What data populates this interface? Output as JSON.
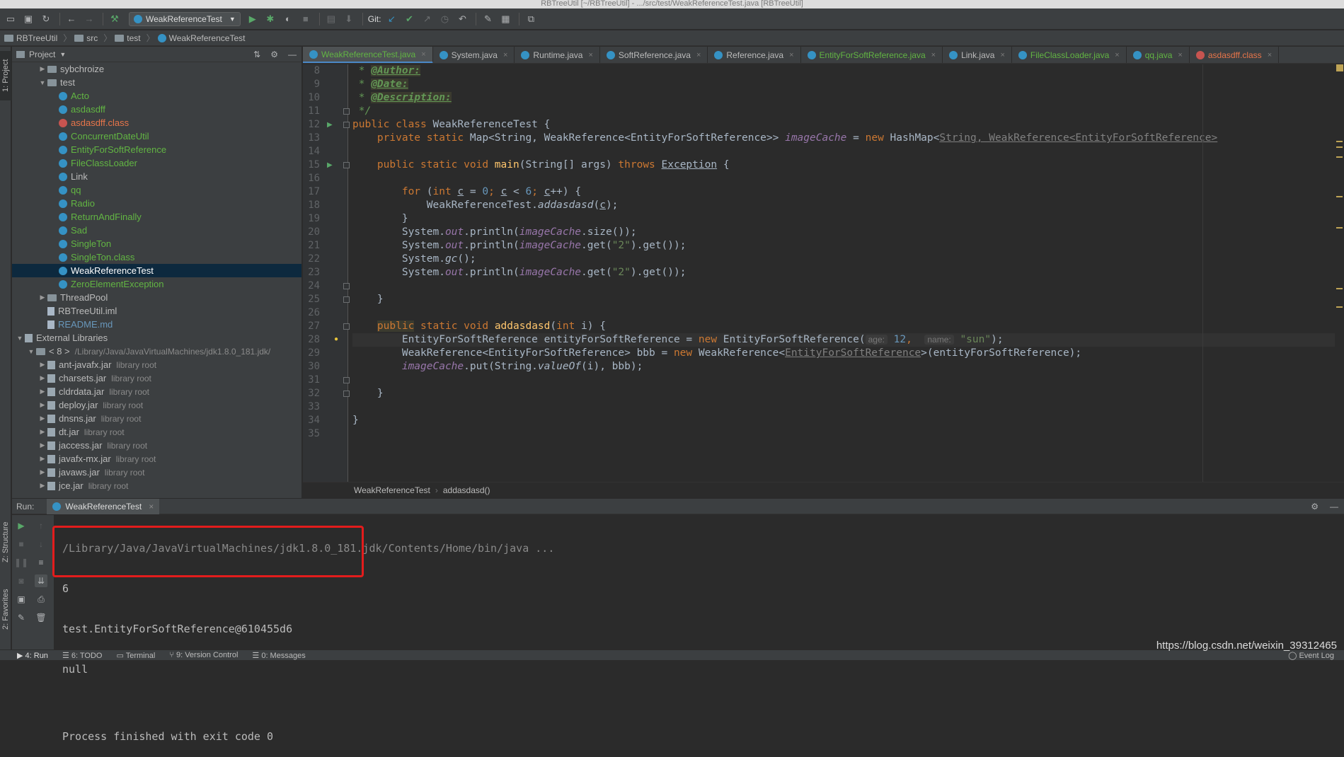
{
  "window": {
    "title": "RBTreeUtil [~/RBTreeUtil] - .../src/test/WeakReferenceTest.java [RBTreeUtil]"
  },
  "toolbar": {
    "run_config": "WeakReferenceTest",
    "git_label": "Git:"
  },
  "breadcrumb": {
    "items": [
      "RBTreeUtil",
      "src",
      "test",
      "WeakReferenceTest"
    ]
  },
  "left_strip": {
    "project": "1: Project",
    "structure": "Z: Structure",
    "favorites": "2: Favorites"
  },
  "project_panel": {
    "title": "Project",
    "tree": [
      {
        "label": "sybchroize",
        "type": "folder",
        "indent": 2,
        "arrow": "▶",
        "color": "white"
      },
      {
        "label": "test",
        "type": "folder",
        "indent": 2,
        "arrow": "▼",
        "color": "white"
      },
      {
        "label": "Acto",
        "type": "class",
        "indent": 3,
        "color": "green"
      },
      {
        "label": "asdasdff",
        "type": "class",
        "indent": 3,
        "color": "green"
      },
      {
        "label": "asdasdff.class",
        "type": "class-err",
        "indent": 3,
        "color": "red"
      },
      {
        "label": "ConcurrentDateUtil",
        "type": "class",
        "indent": 3,
        "color": "green"
      },
      {
        "label": "EntityForSoftReference",
        "type": "class",
        "indent": 3,
        "color": "green"
      },
      {
        "label": "FileClassLoader",
        "type": "class",
        "indent": 3,
        "color": "green"
      },
      {
        "label": "Link",
        "type": "class",
        "indent": 3,
        "color": "white"
      },
      {
        "label": "qq",
        "type": "class",
        "indent": 3,
        "color": "green"
      },
      {
        "label": "Radio",
        "type": "class",
        "indent": 3,
        "color": "green"
      },
      {
        "label": "ReturnAndFinally",
        "type": "class",
        "indent": 3,
        "color": "green"
      },
      {
        "label": "Sad",
        "type": "class",
        "indent": 3,
        "color": "green"
      },
      {
        "label": "SingleTon",
        "type": "class",
        "indent": 3,
        "color": "green"
      },
      {
        "label": "SingleTon.class",
        "type": "class",
        "indent": 3,
        "color": "green"
      },
      {
        "label": "WeakReferenceTest",
        "type": "class",
        "indent": 3,
        "color": "white",
        "selected": true
      },
      {
        "label": "ZeroElementException",
        "type": "class",
        "indent": 3,
        "color": "green"
      },
      {
        "label": "ThreadPool",
        "type": "folder",
        "indent": 2,
        "arrow": "▶",
        "color": "white"
      },
      {
        "label": "RBTreeUtil.iml",
        "type": "file",
        "indent": 2,
        "color": "white"
      },
      {
        "label": "README.md",
        "type": "file",
        "indent": 2,
        "color": "blue"
      },
      {
        "label": "External Libraries",
        "type": "lib",
        "indent": 0,
        "arrow": "▼",
        "color": "white"
      },
      {
        "label": "< 8 >",
        "type": "folder",
        "indent": 1,
        "arrow": "▼",
        "color": "white",
        "extra": "/Library/Java/JavaVirtualMachines/jdk1.8.0_181.jdk/"
      },
      {
        "label": "ant-javafx.jar",
        "type": "jar",
        "indent": 2,
        "arrow": "▶",
        "color": "white",
        "extra": "library root"
      },
      {
        "label": "charsets.jar",
        "type": "jar",
        "indent": 2,
        "arrow": "▶",
        "color": "white",
        "extra": "library root"
      },
      {
        "label": "cldrdata.jar",
        "type": "jar",
        "indent": 2,
        "arrow": "▶",
        "color": "white",
        "extra": "library root"
      },
      {
        "label": "deploy.jar",
        "type": "jar",
        "indent": 2,
        "arrow": "▶",
        "color": "white",
        "extra": "library root"
      },
      {
        "label": "dnsns.jar",
        "type": "jar",
        "indent": 2,
        "arrow": "▶",
        "color": "white",
        "extra": "library root"
      },
      {
        "label": "dt.jar",
        "type": "jar",
        "indent": 2,
        "arrow": "▶",
        "color": "white",
        "extra": "library root"
      },
      {
        "label": "jaccess.jar",
        "type": "jar",
        "indent": 2,
        "arrow": "▶",
        "color": "white",
        "extra": "library root"
      },
      {
        "label": "javafx-mx.jar",
        "type": "jar",
        "indent": 2,
        "arrow": "▶",
        "color": "white",
        "extra": "library root"
      },
      {
        "label": "javaws.jar",
        "type": "jar",
        "indent": 2,
        "arrow": "▶",
        "color": "white",
        "extra": "library root"
      },
      {
        "label": "jce.jar",
        "type": "jar",
        "indent": 2,
        "arrow": "▶",
        "color": "white",
        "extra": "library root"
      }
    ]
  },
  "editor_tabs": [
    {
      "label": "WeakReferenceTest.java",
      "active": true,
      "color": "green"
    },
    {
      "label": "System.java",
      "color": "white"
    },
    {
      "label": "Runtime.java",
      "color": "white"
    },
    {
      "label": "SoftReference.java",
      "color": "white"
    },
    {
      "label": "Reference.java",
      "color": "white"
    },
    {
      "label": "EntityForSoftReference.java",
      "color": "green"
    },
    {
      "label": "Link.java",
      "color": "white"
    },
    {
      "label": "FileClassLoader.java",
      "color": "green"
    },
    {
      "label": "qq.java",
      "color": "green"
    },
    {
      "label": "asdasdff.class",
      "color": "red"
    }
  ],
  "editor": {
    "first_line": 8,
    "line_numbers": [
      "8",
      "9",
      "10",
      "11",
      "12",
      "13",
      "14",
      "15",
      "16",
      "17",
      "18",
      "19",
      "20",
      "21",
      "22",
      "23",
      "24",
      "25",
      "26",
      "27",
      "28",
      "29",
      "30",
      "31",
      "32",
      "33",
      "34",
      "35"
    ],
    "lines": [
      [
        {
          "t": " * ",
          "c": "cm"
        },
        {
          "t": "@Author:",
          "c": "tag"
        }
      ],
      [
        {
          "t": " * ",
          "c": "cm"
        },
        {
          "t": "@Date:",
          "c": "tag"
        }
      ],
      [
        {
          "t": " * ",
          "c": "cm"
        },
        {
          "t": "@Description:",
          "c": "tag"
        }
      ],
      [
        {
          "t": " */",
          "c": "cm"
        }
      ],
      [
        {
          "t": "public class ",
          "c": "kw"
        },
        {
          "t": "WeakReferenceTest {",
          "c": ""
        }
      ],
      [
        {
          "t": "    private static ",
          "c": "kw"
        },
        {
          "t": "Map<String, WeakReference<EntityForSoftReference>> ",
          "c": ""
        },
        {
          "t": "imageCache",
          "c": "fld"
        },
        {
          "t": " = ",
          "c": ""
        },
        {
          "t": "new ",
          "c": "kw"
        },
        {
          "t": "HashMap<",
          "c": ""
        },
        {
          "t": "String, WeakReference<EntityForSoftReference>",
          "c": "grey ul"
        }
      ],
      [],
      [
        {
          "t": "    public static void ",
          "c": "kw"
        },
        {
          "t": "main",
          "c": "fn"
        },
        {
          "t": "(String[] args) ",
          "c": ""
        },
        {
          "t": "throws ",
          "c": "kw"
        },
        {
          "t": "Exception",
          "c": "ul"
        },
        {
          "t": " {",
          "c": ""
        }
      ],
      [],
      [
        {
          "t": "        for ",
          "c": "kw"
        },
        {
          "t": "(",
          "c": ""
        },
        {
          "t": "int ",
          "c": "kw"
        },
        {
          "t": "c",
          "c": "ul"
        },
        {
          "t": " = ",
          "c": ""
        },
        {
          "t": "0",
          "c": "num"
        },
        {
          "t": "; ",
          "c": "kw"
        },
        {
          "t": "c",
          "c": "ul"
        },
        {
          "t": " < ",
          "c": ""
        },
        {
          "t": "6",
          "c": "num"
        },
        {
          "t": "; ",
          "c": "kw"
        },
        {
          "t": "c",
          "c": "ul"
        },
        {
          "t": "++) {",
          "c": ""
        }
      ],
      [
        {
          "t": "            WeakReferenceTest.",
          "c": ""
        },
        {
          "t": "addasdasd",
          "c": "st"
        },
        {
          "t": "(",
          "c": ""
        },
        {
          "t": "c",
          "c": "ul"
        },
        {
          "t": ");",
          "c": ""
        }
      ],
      [
        {
          "t": "        }",
          "c": ""
        }
      ],
      [
        {
          "t": "        System.",
          "c": ""
        },
        {
          "t": "out",
          "c": "fld"
        },
        {
          "t": ".println(",
          "c": ""
        },
        {
          "t": "imageCache",
          "c": "fld"
        },
        {
          "t": ".size());",
          "c": ""
        }
      ],
      [
        {
          "t": "        System.",
          "c": ""
        },
        {
          "t": "out",
          "c": "fld"
        },
        {
          "t": ".println(",
          "c": ""
        },
        {
          "t": "imageCache",
          "c": "fld"
        },
        {
          "t": ".get(",
          "c": ""
        },
        {
          "t": "\"2\"",
          "c": "str"
        },
        {
          "t": ").get());",
          "c": ""
        }
      ],
      [
        {
          "t": "        System.",
          "c": ""
        },
        {
          "t": "gc",
          "c": "st"
        },
        {
          "t": "();",
          "c": ""
        }
      ],
      [
        {
          "t": "        System.",
          "c": ""
        },
        {
          "t": "out",
          "c": "fld"
        },
        {
          "t": ".println(",
          "c": ""
        },
        {
          "t": "imageCache",
          "c": "fld"
        },
        {
          "t": ".get(",
          "c": ""
        },
        {
          "t": "\"2\"",
          "c": "str"
        },
        {
          "t": ").get());",
          "c": ""
        }
      ],
      [],
      [
        {
          "t": "    }",
          "c": ""
        }
      ],
      [],
      [
        {
          "t": "    ",
          "c": ""
        },
        {
          "t": "public",
          "c": "kw tagbg"
        },
        {
          "t": " static void ",
          "c": "kw"
        },
        {
          "t": "addasdasd",
          "c": "fn"
        },
        {
          "t": "(",
          "c": ""
        },
        {
          "t": "int ",
          "c": "kw"
        },
        {
          "t": "i) {",
          "c": ""
        }
      ],
      [
        {
          "t": "        EntityForSoftReference entityForSoftReference = ",
          "c": ""
        },
        {
          "t": "new ",
          "c": "kw"
        },
        {
          "t": "EntityForSoftReference(",
          "c": ""
        },
        {
          "t": "age:",
          "c": "hint"
        },
        {
          "t": " 12",
          "c": "num"
        },
        {
          "t": ",  ",
          "c": "kw"
        },
        {
          "t": "name:",
          "c": "hint"
        },
        {
          "t": " \"sun\"",
          "c": "str"
        },
        {
          "t": ");",
          "c": ""
        }
      ],
      [
        {
          "t": "        WeakReference<EntityForSoftReference> bbb = ",
          "c": ""
        },
        {
          "t": "new ",
          "c": "kw"
        },
        {
          "t": "WeakReference<",
          "c": ""
        },
        {
          "t": "EntityForSoftReference",
          "c": "grey ul"
        },
        {
          "t": ">(entityForSoftReference);",
          "c": ""
        }
      ],
      [
        {
          "t": "        ",
          "c": ""
        },
        {
          "t": "imageCache",
          "c": "fld"
        },
        {
          "t": ".put(String.",
          "c": ""
        },
        {
          "t": "valueOf",
          "c": "st"
        },
        {
          "t": "(i), bbb);",
          "c": ""
        }
      ],
      [],
      [
        {
          "t": "    }",
          "c": ""
        }
      ],
      [],
      [
        {
          "t": "}",
          "c": ""
        }
      ],
      []
    ]
  },
  "editor_breadcrumb": {
    "class_name": "WeakReferenceTest",
    "method": "addasdasd()"
  },
  "run_panel": {
    "label": "Run:",
    "tab": "WeakReferenceTest"
  },
  "console": {
    "lines": [
      "/Library/Java/JavaVirtualMachines/jdk1.8.0_181.jdk/Contents/Home/bin/java ...",
      "6",
      "test.EntityForSoftReference@610455d6",
      "null",
      "",
      "Process finished with exit code 0"
    ]
  },
  "statusbar": {
    "items": [
      "4: Run",
      "6: TODO",
      "Terminal",
      "9: Version Control",
      "0: Messages"
    ],
    "event_log": "Event Log"
  },
  "watermark": "https://blog.csdn.net/weixin_39312465"
}
